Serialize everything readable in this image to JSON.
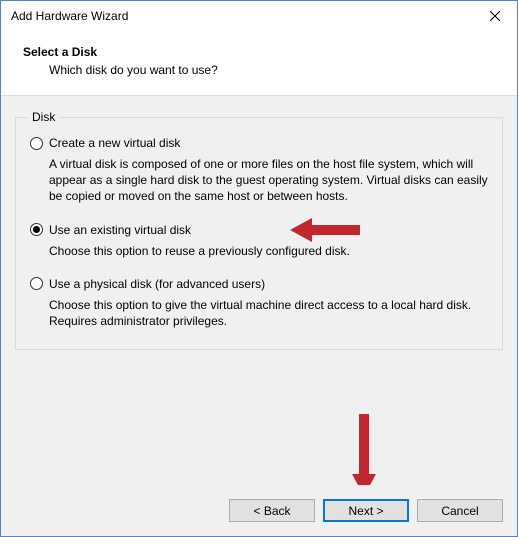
{
  "window": {
    "title": "Add Hardware Wizard"
  },
  "header": {
    "heading": "Select a Disk",
    "sub": "Which disk do you want to use?"
  },
  "group": {
    "legend": "Disk"
  },
  "options": {
    "create": {
      "label": "Create a new virtual disk",
      "desc": "A virtual disk is composed of one or more files on the host file system, which will appear as a single hard disk to the guest operating system. Virtual disks can easily be copied or moved on the same host or between hosts.",
      "selected": false
    },
    "existing": {
      "label": "Use an existing virtual disk",
      "desc": "Choose this option to reuse a previously configured disk.",
      "selected": true
    },
    "physical": {
      "label": "Use a physical disk (for advanced users)",
      "desc": "Choose this option to give the virtual machine direct access to a local hard disk. Requires administrator privileges.",
      "selected": false
    }
  },
  "buttons": {
    "back": "< Back",
    "next": "Next >",
    "cancel": "Cancel"
  },
  "annotations": {
    "arrow_color": "#c1272d"
  }
}
